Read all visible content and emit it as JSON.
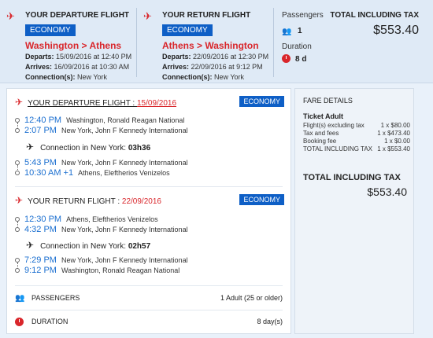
{
  "departure_summary": {
    "heading": "YOUR DEPARTURE FLIGHT",
    "cabin": "ECONOMY",
    "route": "Washington > Athens",
    "departs_label": "Departs:",
    "departs_value": "15/09/2016 at 12:40 PM",
    "arrives_label": "Arrives:",
    "arrives_value": "16/09/2016 at 10:30 AM",
    "connections_label": "Connection(s):",
    "connections_value": "New York"
  },
  "return_summary": {
    "heading": "YOUR RETURN FLIGHT",
    "cabin": "ECONOMY",
    "route": "Athens > Washington",
    "departs_label": "Departs:",
    "departs_value": "22/09/2016 at 12:30 PM",
    "arrives_label": "Arrives:",
    "arrives_value": "22/09/2016 at 9:12 PM",
    "connections_label": "Connection(s):",
    "connections_value": "New York"
  },
  "passengers": {
    "label": "Passengers",
    "value": "1"
  },
  "duration": {
    "label": "Duration",
    "value": "8 d"
  },
  "total": {
    "label": "TOTAL INCLUDING TAX",
    "value": "$553.40"
  },
  "departure_detail": {
    "label": "YOUR DEPARTURE FLIGHT : ",
    "date": "15/09/2016",
    "cabin": "ECONOMY",
    "seg1": {
      "dep_time": "12:40 PM",
      "dep_place": "Washington, Ronald Reagan National",
      "arr_time": "2:07 PM",
      "arr_place": "New York, John F Kennedy International"
    },
    "connection_label": "Connection in New York:",
    "connection_time": "03h36",
    "seg2": {
      "dep_time": "5:43 PM",
      "dep_place": "New York, John F Kennedy International",
      "arr_time": "10:30 AM +1",
      "arr_place": "Athens, Eleftherios Venizelos"
    }
  },
  "return_detail": {
    "label": "YOUR RETURN FLIGHT : ",
    "date": "22/09/2016",
    "cabin": "ECONOMY",
    "seg1": {
      "dep_time": "12:30 PM",
      "dep_place": "Athens, Eleftherios Venizelos",
      "arr_time": "4:32 PM",
      "arr_place": "New York, John F Kennedy International"
    },
    "connection_label": "Connection in New York:",
    "connection_time": "02h57",
    "seg2": {
      "dep_time": "7:29 PM",
      "dep_place": "New York, John F Kennedy International",
      "arr_time": "9:12 PM",
      "arr_place": "Washington, Ronald Reagan National"
    }
  },
  "info_rows": {
    "passengers_label": "PASSENGERS",
    "passengers_value": "1 Adult (25 or older)",
    "duration_label": "DURATION",
    "duration_value": "8 day(s)"
  },
  "fare": {
    "title": "FARE DETAILS",
    "subtitle": "Ticket Adult",
    "lines": [
      {
        "label": "Flight(s) excluding tax",
        "value": "1 x $80.00"
      },
      {
        "label": "Tax and fees",
        "value": "1 x $473.40"
      },
      {
        "label": "Booking fee",
        "value": "1 x $0.00"
      },
      {
        "label": "TOTAL INCLUDING TAX",
        "value": "1 x $553.40"
      }
    ],
    "total_label": "TOTAL INCLUDING TAX",
    "total_value": "$553.40"
  },
  "icons": {
    "plane": "airplane-icon",
    "passengers": "people-icon",
    "clock": "clock-icon",
    "connection": "connecting-flight-icon"
  },
  "colors": {
    "accent_red": "#d9262b",
    "badge_blue": "#0e5fc6",
    "time_blue": "#1b6fd0",
    "summary_bg": "#dfeaf6",
    "page_bg": "#e9f1fa"
  }
}
